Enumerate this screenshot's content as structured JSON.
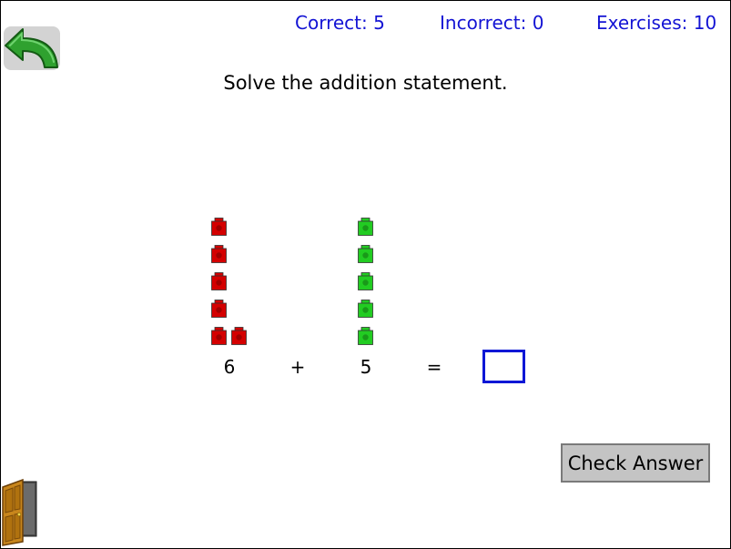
{
  "scoreboard": {
    "correct": "Correct: 5",
    "incorrect": "Incorrect: 0",
    "exercises": "Exercises: 10"
  },
  "instruction": "Solve the addition statement.",
  "equation": {
    "left_operand": "6",
    "operator": "+",
    "right_operand": "5",
    "equals": "=",
    "answer_value": ""
  },
  "blocks": {
    "left_count": 6,
    "left_color": "#d40000",
    "right_count": 5,
    "right_color": "#22cc22"
  },
  "buttons": {
    "check_answer": "Check Answer"
  },
  "icons": {
    "back": "back-arrow-icon",
    "exit": "door-icon"
  },
  "colors": {
    "score_text": "#1414d4",
    "answer_border": "#0b17d6",
    "button_bg": "#c4c4c4"
  }
}
